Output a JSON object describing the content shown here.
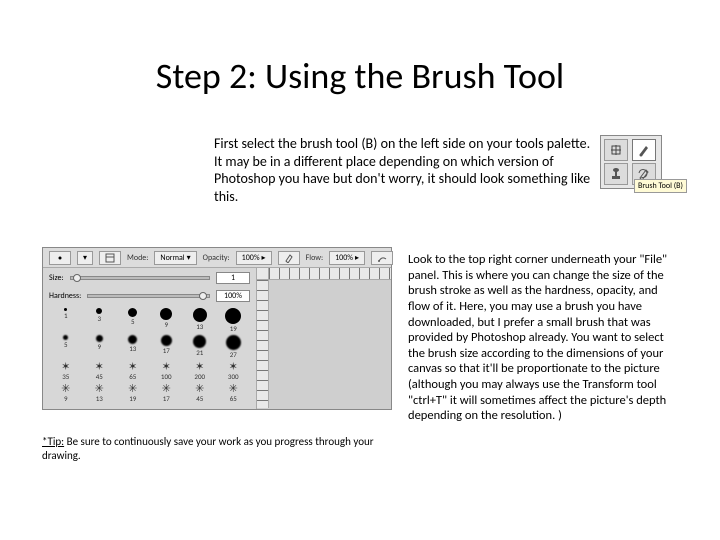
{
  "title": "Step 2: Using the Brush Tool",
  "intro": "First select the brush tool (B) on the left side on your tools palette. It may be in a different place depending on which version of Photoshop you have but don't worry, it should look something like this.",
  "tools_tooltip": "Brush Tool (B)",
  "options": {
    "mode_label": "Mode:",
    "mode_value": "Normal",
    "opacity_label": "Opacity:",
    "opacity_value": "100%",
    "flow_label": "Flow:",
    "flow_value": "100%",
    "size_label": "Size:",
    "size_value": "1",
    "hardness_label": "Hardness:",
    "hardness_value": "100%",
    "preset_labels": [
      "1",
      "3",
      "5",
      "9",
      "13",
      "19",
      "5",
      "9",
      "13",
      "17",
      "21",
      "27",
      "35",
      "45",
      "65",
      "100",
      "200",
      "300",
      "9",
      "13",
      "19",
      "17",
      "45",
      "65"
    ]
  },
  "body": "Look to the top right corner underneath your \"File\" panel. This is where you can change the size of the brush stroke as well as the hardness, opacity, and flow of it. Here, you may use a brush you have downloaded, but I prefer a small brush that was provided by Photoshop already. You want to select the brush size according to the dimensions of your canvas so that it'll be proportionate to the picture (although you may always use the Transform tool \"ctrl+T\" it will sometimes affect the picture's depth depending on the resolution. )",
  "tip": {
    "label": "*Tip:",
    "text": " Be sure to continuously save your work as you progress through your drawing."
  }
}
